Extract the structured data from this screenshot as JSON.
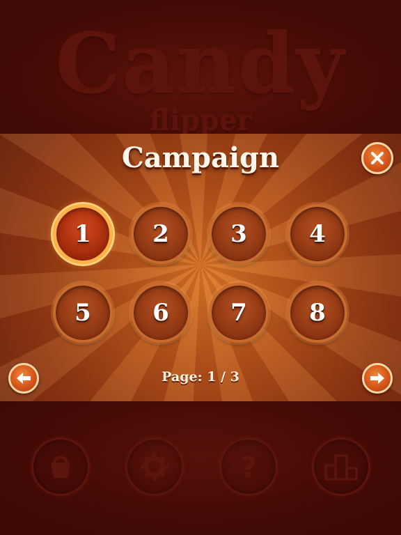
{
  "background": {
    "logo_title": "Candy",
    "logo_subtitle": "flipper",
    "menu_icons": [
      "basket-icon",
      "gear-icon",
      "question-icon",
      "podium-icon"
    ]
  },
  "panel": {
    "title": "Campaign",
    "close_icon": "close-icon",
    "levels": [
      "1",
      "2",
      "3",
      "4",
      "5",
      "6",
      "7",
      "8"
    ],
    "selected_level": "1",
    "page_label": "Page: 1 / 3",
    "prev_icon": "arrow-left-icon",
    "next_icon": "arrow-right-icon"
  },
  "colors": {
    "panel_center": "#d9782a",
    "panel_edge": "#6f2a12",
    "selected_ring": "#ffb24a",
    "dark_background": "#4a0b06"
  }
}
